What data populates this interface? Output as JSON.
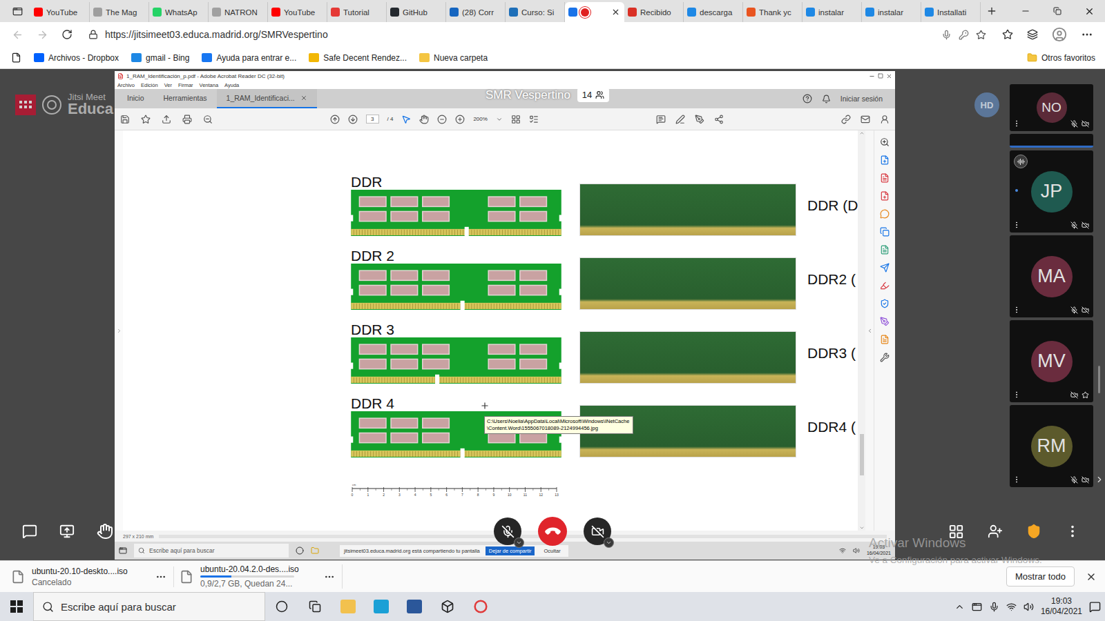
{
  "browser": {
    "tabs": [
      {
        "label": "YouTube",
        "selected": false,
        "recording": false,
        "color": "#ff0000"
      },
      {
        "label": "The Mag",
        "selected": false,
        "recording": false,
        "color": "#9e9e9e"
      },
      {
        "label": "WhatsAp",
        "selected": false,
        "recording": false,
        "color": "#25d366"
      },
      {
        "label": "NATRON",
        "selected": false,
        "recording": false,
        "color": "#a0a0a0"
      },
      {
        "label": "YouTube",
        "selected": false,
        "recording": false,
        "color": "#ff0000"
      },
      {
        "label": "Tutorial",
        "selected": false,
        "recording": false,
        "color": "#e53935"
      },
      {
        "label": "GitHub",
        "selected": false,
        "recording": false,
        "color": "#24292e"
      },
      {
        "label": "(28) Corr",
        "selected": false,
        "recording": false,
        "color": "#1565c0"
      },
      {
        "label": "Curso: Si",
        "selected": false,
        "recording": false,
        "color": "#1e6fb8"
      },
      {
        "label": "",
        "selected": true,
        "recording": true,
        "color": "#1a73e8"
      },
      {
        "label": "Recibido",
        "selected": false,
        "recording": false,
        "color": "#d93025"
      },
      {
        "label": "descarga",
        "selected": false,
        "recording": false,
        "color": "#1e88e5"
      },
      {
        "label": "Thank yc",
        "selected": false,
        "recording": false,
        "color": "#e95420"
      },
      {
        "label": "instalar",
        "selected": false,
        "recording": false,
        "color": "#1e88e5"
      },
      {
        "label": "instalar",
        "selected": false,
        "recording": false,
        "color": "#1e88e5"
      },
      {
        "label": "Installati",
        "selected": false,
        "recording": false,
        "color": "#1e88e5"
      }
    ],
    "url": "https://jitsimeet03.educa.madrid.org/SMRVespertino",
    "bookmarks": [
      {
        "label": "Archivos - Dropbox",
        "color": "#0061fe"
      },
      {
        "label": "gmail - Bing",
        "color": "#1e88e5"
      },
      {
        "label": "Ayuda para entrar e...",
        "color": "#1877f2"
      },
      {
        "label": "Safe Decent Rendez...",
        "color": "#f2b705"
      },
      {
        "label": "Nueva carpeta",
        "color": "#f4c542"
      }
    ],
    "other_favorites": "Otros favoritos"
  },
  "meeting": {
    "logo": {
      "brand": "Jitsi Meet",
      "org": "Educa"
    },
    "title": "SMR Vespertino",
    "participant_count": "14",
    "self_avatar": "HD",
    "participants": [
      {
        "initials": "NO",
        "color": "#5b2a38",
        "audio_muted": true,
        "video_muted": true,
        "speaking": false,
        "moderator": false
      },
      {
        "initials": "JP",
        "color": "#1f5a50",
        "audio_muted": true,
        "video_muted": true,
        "speaking": true,
        "moderator": false
      },
      {
        "initials": "MA",
        "color": "#6a2c3e",
        "audio_muted": true,
        "video_muted": true,
        "speaking": false,
        "moderator": false
      },
      {
        "initials": "MV",
        "color": "#6a2c3e",
        "audio_muted": true,
        "video_muted": true,
        "speaking": false,
        "moderator": true
      },
      {
        "initials": "RM",
        "color": "#5c5a2c",
        "audio_muted": true,
        "video_muted": true,
        "speaking": false,
        "moderator": false
      }
    ],
    "toolbar": {
      "mic_muted": true,
      "camera_off": true
    }
  },
  "acrobat": {
    "title": "1_RAM_Identificación_p.pdf - Adobe Acrobat Reader DC (32-bit)",
    "menu": [
      "Archivo",
      "Edición",
      "Ver",
      "Firmar",
      "Ventana",
      "Ayuda"
    ],
    "tabs": [
      {
        "label": "Inicio",
        "selected": false
      },
      {
        "label": "Herramientas",
        "selected": false
      },
      {
        "label": "1_RAM_Identificaci...",
        "selected": true
      }
    ],
    "sign_in": "Iniciar sesión",
    "page": "3",
    "pages": "/ 4",
    "zoom": "200%",
    "page_size": "297 x 210 mm",
    "modules": [
      {
        "label": "DDR",
        "caption": "DDR (D",
        "notch": 0.55
      },
      {
        "label": "DDR 2",
        "caption": "DDR2 (",
        "notch": 0.53
      },
      {
        "label": "DDR 3",
        "caption": "DDR3 (",
        "notch": 0.41
      },
      {
        "label": "DDR 4",
        "caption": "DDR4 (",
        "notch": 0.53
      }
    ],
    "tooltip": "C:\\Users\\Noelia\\AppData\\Local\\Microsoft\\Windows\\INetCache\\Content.Word\\1555067018089-2124994456.jpg",
    "ruler": {
      "unit": "cm",
      "labels": [
        "0",
        "1",
        "2",
        "3",
        "4",
        "5",
        "6",
        "7",
        "8",
        "9",
        "10",
        "11",
        "12",
        "13"
      ]
    },
    "inner_taskbar": {
      "search": "Escribe aquí para buscar",
      "share_notice": "jitsimeet03.educa.madrid.org está compartiendo tu pantalla",
      "stop_share": "Dejar de compartir",
      "hide": "Ocultar",
      "time": "19:03",
      "date": "16/04/2021"
    }
  },
  "downloads": [
    {
      "name": "ubuntu-20.10-deskto....iso",
      "status": "Cancelado",
      "kind": "cancelled",
      "level": 0
    },
    {
      "name": "ubuntu-20.04.2.0-des....iso",
      "status": "0,9/2,7 GB, Quedan 24...",
      "kind": "progress",
      "level": 0.33
    }
  ],
  "show_all": "Mostrar todo",
  "watermark": {
    "title": "Activar Windows",
    "subtitle": "Ve a Configuración para activar Windows."
  },
  "taskbar": {
    "search": "Escribe aquí para buscar",
    "time": "19:03",
    "date": "16/04/2021"
  }
}
